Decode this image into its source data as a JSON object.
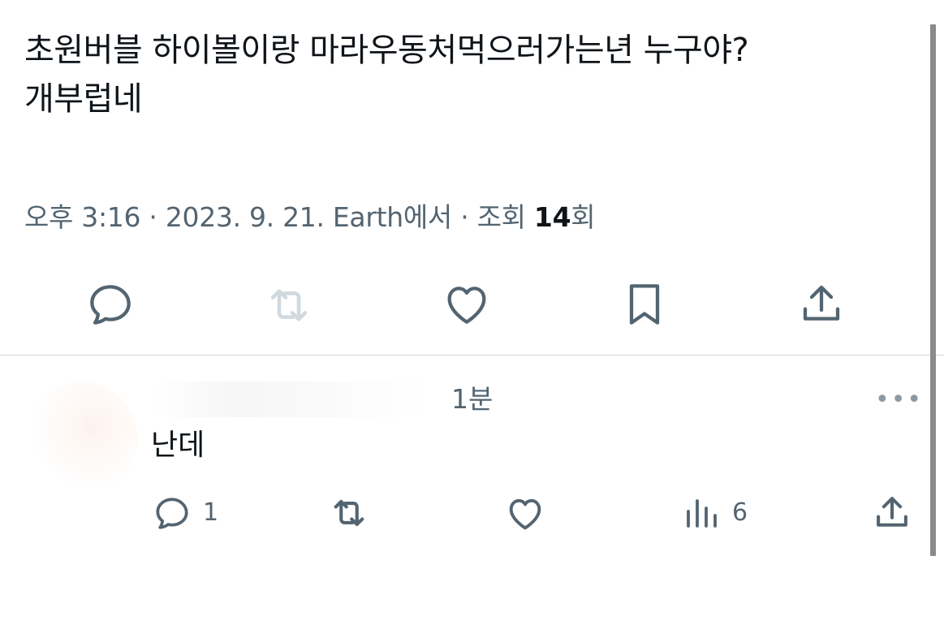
{
  "tweet": {
    "text_line1": "초원버블  하이볼이랑 마라우동처먹으러가는년 누구야?",
    "text_line2": "개부럽네",
    "time": "오후 3:16",
    "separator1": "·",
    "date": "2023. 9. 21.",
    "source": "Earth에서",
    "separator2": "·",
    "views_label": "조회",
    "views_count": "14",
    "views_suffix": "회"
  },
  "actions": [
    {
      "name": "reply-icon"
    },
    {
      "name": "retweet-icon",
      "disabled": true
    },
    {
      "name": "like-icon"
    },
    {
      "name": "bookmark-icon"
    },
    {
      "name": "share-icon"
    }
  ],
  "reply": {
    "time": "1분",
    "more": "•••",
    "text": "난데",
    "reply_count": "1",
    "views_count": "6"
  },
  "colors": {
    "text": "#0f1419",
    "secondary": "#536471",
    "icon_disabled": "#cfd9de",
    "divider": "#cfd9de"
  }
}
